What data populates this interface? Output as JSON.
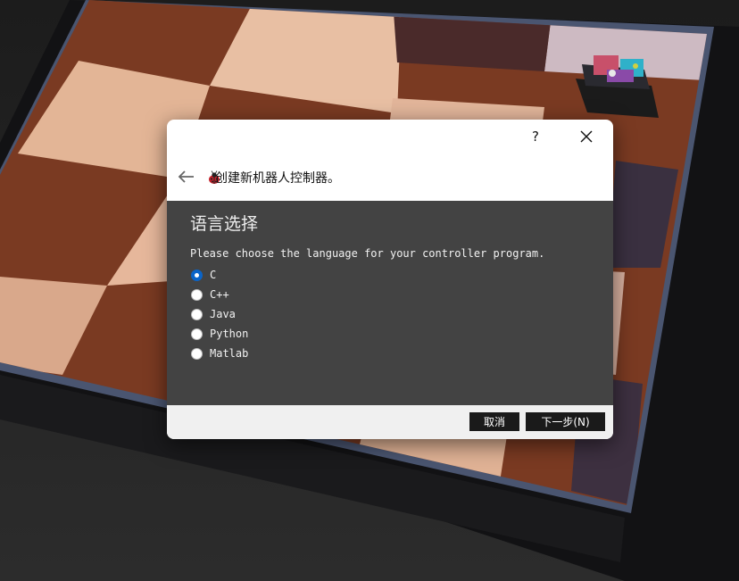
{
  "dialog": {
    "help_label": "?",
    "title": "创建新机器人控制器。",
    "page_title": "语言选择",
    "prompt": "Please choose the language for your controller program.",
    "languages": [
      {
        "label": "C",
        "selected": true
      },
      {
        "label": "C++",
        "selected": false
      },
      {
        "label": "Java",
        "selected": false
      },
      {
        "label": "Python",
        "selected": false
      },
      {
        "label": "Matlab",
        "selected": false
      }
    ],
    "cancel_label": "取消",
    "next_label": "下一步(N)"
  },
  "icons": {
    "back": "arrow-left-icon",
    "close": "close-icon",
    "title_icon": "ladybug-icon"
  },
  "colors": {
    "content_bg": "#434343",
    "accent": "#0a64c8",
    "button_bg": "#1a1a1a"
  }
}
